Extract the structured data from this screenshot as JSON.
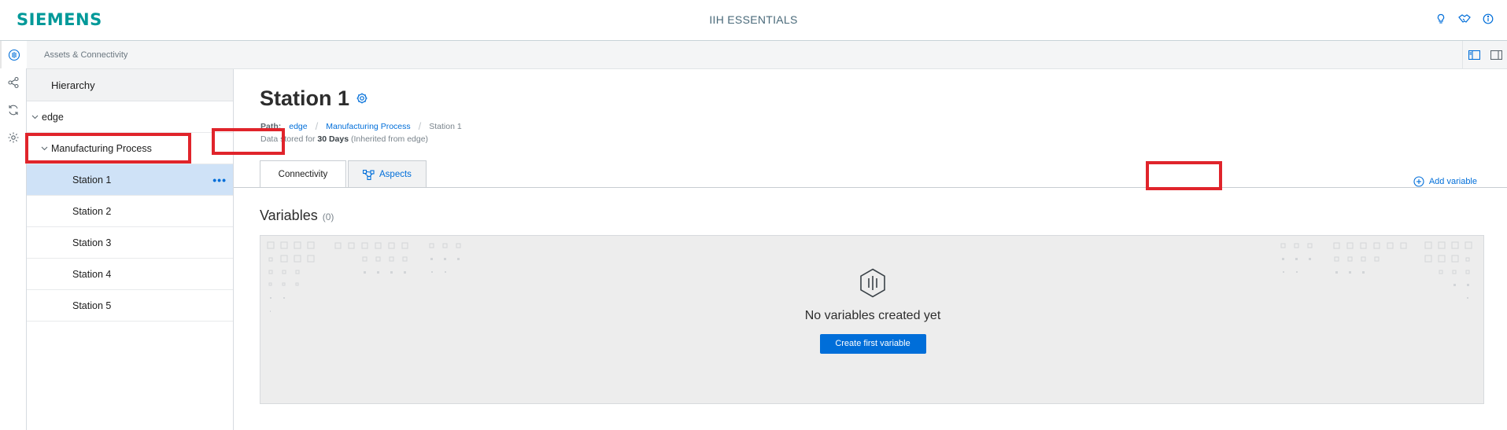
{
  "header": {
    "brand": "SIEMENS",
    "app_title": "IIH ESSENTIALS",
    "icons": [
      "lightbulb-icon",
      "handshake-icon",
      "info-icon"
    ]
  },
  "rail": {
    "items": [
      "connectivity-icon",
      "share-network-icon",
      "sync-icon",
      "settings-icon"
    ]
  },
  "breadcrumb": {
    "text": "Assets & Connectivity",
    "right_icons": [
      "panel-left-icon",
      "panel-right-icon"
    ]
  },
  "hierarchy": {
    "title": "Hierarchy",
    "items": [
      {
        "label": "edge",
        "level": 0,
        "expandable": true
      },
      {
        "label": "Manufacturing Process",
        "level": 1,
        "expandable": true
      },
      {
        "label": "Station 1",
        "level": 2,
        "selected": true,
        "more": "•••"
      },
      {
        "label": "Station 2",
        "level": 2
      },
      {
        "label": "Station 3",
        "level": 2
      },
      {
        "label": "Station 4",
        "level": 2
      },
      {
        "label": "Station 5",
        "level": 2
      }
    ]
  },
  "main": {
    "title": "Station 1",
    "path_label": "Path:",
    "path": [
      "edge",
      "Manufacturing Process",
      "Station 1"
    ],
    "stored_prefix": "Data stored for",
    "stored_days": "30 Days",
    "stored_suffix": "(Inherited from edge)",
    "tabs": [
      {
        "label": "Connectivity",
        "active": true
      },
      {
        "label": "Aspects",
        "active": false
      }
    ],
    "variables_title": "Variables",
    "variables_count": "(0)",
    "add_variable": "Add variable",
    "empty_message": "No variables created yet",
    "create_button": "Create first variable"
  },
  "colors": {
    "brand": "#009999",
    "accent": "#006ed9",
    "selected_row": "#cfe2f7",
    "highlight": "#e0242b"
  }
}
